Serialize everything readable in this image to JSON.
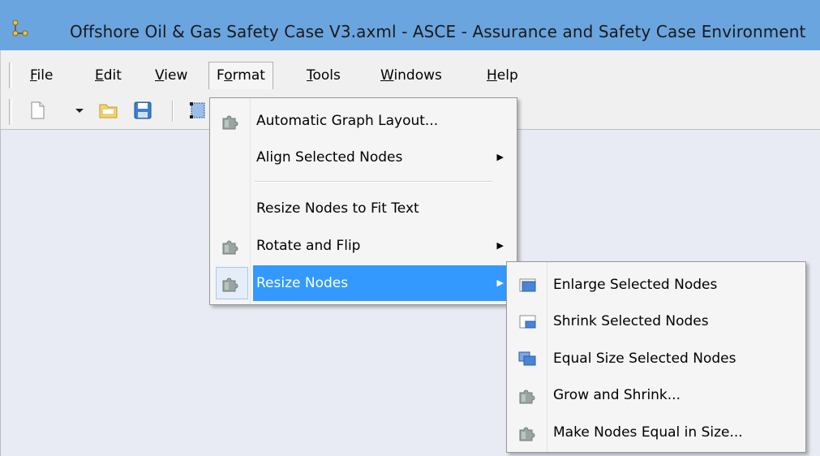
{
  "window": {
    "title": "Offshore Oil & Gas Safety Case V3.axml - ASCE - Assurance and Safety Case Environment",
    "icon": "asce-app-icon"
  },
  "menubar": {
    "items": [
      {
        "pre": "",
        "mn": "F",
        "post": "ile"
      },
      {
        "pre": "",
        "mn": "E",
        "post": "dit"
      },
      {
        "pre": "",
        "mn": "V",
        "post": "iew"
      },
      {
        "pre": "F",
        "mn": "o",
        "post": "rmat"
      },
      {
        "pre": "",
        "mn": "T",
        "post": "ools"
      },
      {
        "pre": "",
        "mn": "W",
        "post": "indows"
      },
      {
        "pre": "",
        "mn": "H",
        "post": "elp"
      }
    ],
    "open_item": "Format"
  },
  "toolbar": {
    "icons": [
      "new-document-icon",
      "dropdown-arrow-icon",
      "open-folder-icon",
      "save-disk-icon",
      "select-node-icon"
    ]
  },
  "format_menu": {
    "items": [
      {
        "label": "Automatic Graph Layout...",
        "icon": "puzzle-icon",
        "submenu": false
      },
      {
        "label": "Align Selected Nodes",
        "icon": "",
        "submenu": true
      },
      {
        "label": "Resize Nodes to Fit Text",
        "icon": "",
        "submenu": false
      },
      {
        "label": "Rotate and Flip",
        "icon": "puzzle-icon",
        "submenu": true
      },
      {
        "label": "Resize Nodes",
        "icon": "puzzle-icon",
        "submenu": true,
        "highlighted": true
      }
    ]
  },
  "resize_submenu": {
    "items": [
      {
        "label": "Enlarge Selected Nodes",
        "icon": "enlarge-nodes-icon"
      },
      {
        "label": "Shrink Selected Nodes",
        "icon": "shrink-nodes-icon"
      },
      {
        "label": "Equal Size Selected Nodes",
        "icon": "equal-size-nodes-icon"
      },
      {
        "label": "Grow and Shrink...",
        "icon": "puzzle-icon"
      },
      {
        "label": "Make Nodes Equal in Size...",
        "icon": "puzzle-icon"
      }
    ]
  },
  "colors": {
    "titlebar": "#6aa5df",
    "highlight": "#3399ff",
    "canvas": "#e9ebf4"
  }
}
